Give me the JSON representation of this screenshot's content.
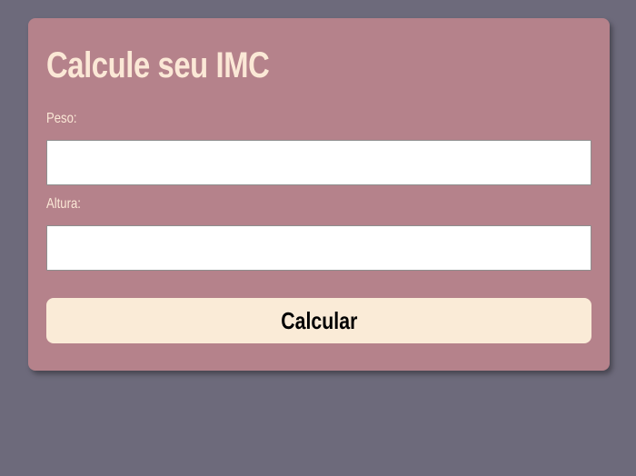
{
  "form": {
    "title": "Calcule seu IMC",
    "weight_label": "Peso:",
    "weight_value": "",
    "height_label": "Altura:",
    "height_value": "",
    "submit_label": "Calcular"
  },
  "colors": {
    "page_background": "#6d6a7b",
    "card_background": "#b5828b",
    "title_text": "#fbe8d6",
    "button_background": "#faebd7"
  }
}
